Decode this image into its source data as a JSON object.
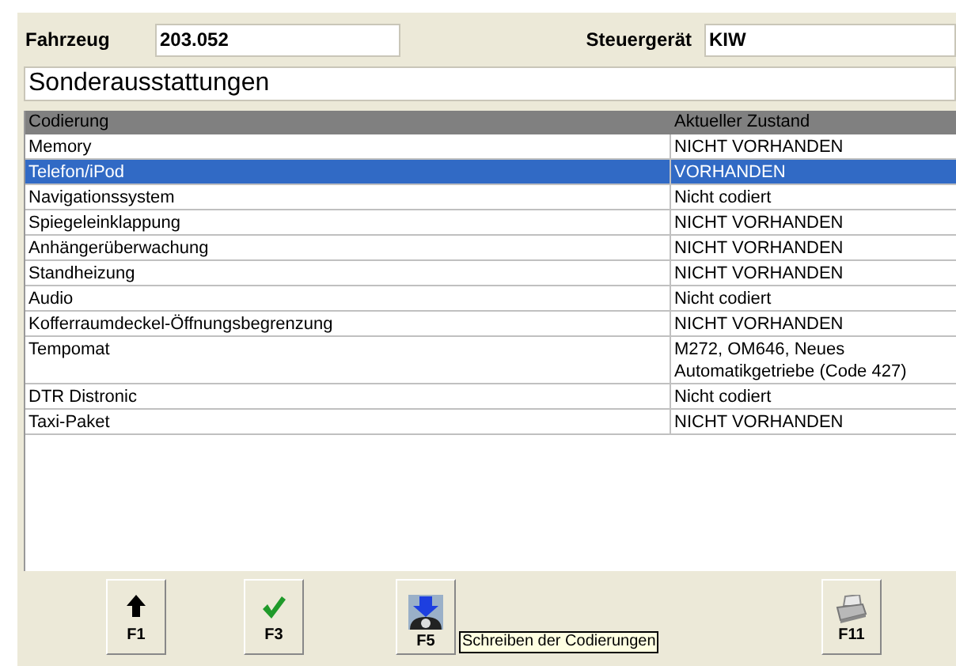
{
  "vehicle": {
    "label": "Fahrzeug",
    "value": "203.052"
  },
  "control_unit": {
    "label": "Steuergerät",
    "value": "KIW"
  },
  "section_title": "Sonderausstattungen",
  "table": {
    "columns": [
      "Codierung",
      "Aktueller Zustand"
    ],
    "rows": [
      {
        "coding": "Memory",
        "state": "NICHT VORHANDEN",
        "selected": false
      },
      {
        "coding": "Telefon/iPod",
        "state": "VORHANDEN",
        "selected": true
      },
      {
        "coding": "Navigationssystem",
        "state": "Nicht codiert",
        "selected": false
      },
      {
        "coding": "Spiegeleinklappung",
        "state": "NICHT VORHANDEN",
        "selected": false
      },
      {
        "coding": "Anhängerüberwachung",
        "state": "NICHT VORHANDEN",
        "selected": false
      },
      {
        "coding": "Standheizung",
        "state": "NICHT VORHANDEN",
        "selected": false
      },
      {
        "coding": "Audio",
        "state": "Nicht codiert",
        "selected": false
      },
      {
        "coding": "Kofferraumdeckel-Öffnungsbegrenzung",
        "state": "NICHT VORHANDEN",
        "selected": false
      },
      {
        "coding": "Tempomat",
        "state": "M272, OM646, Neues Automatikgetriebe (Code 427)",
        "selected": false
      },
      {
        "coding": "DTR Distronic",
        "state": "Nicht codiert",
        "selected": false
      },
      {
        "coding": "Taxi-Paket",
        "state": "NICHT VORHANDEN",
        "selected": false
      }
    ]
  },
  "buttons": [
    {
      "kind": "up",
      "label": "F1"
    },
    {
      "kind": "check",
      "label": "F3"
    },
    {
      "kind": "write",
      "label": "F5",
      "tooltip": "Schreiben der Codierungen"
    },
    {
      "kind": "print",
      "label": "F11"
    }
  ]
}
